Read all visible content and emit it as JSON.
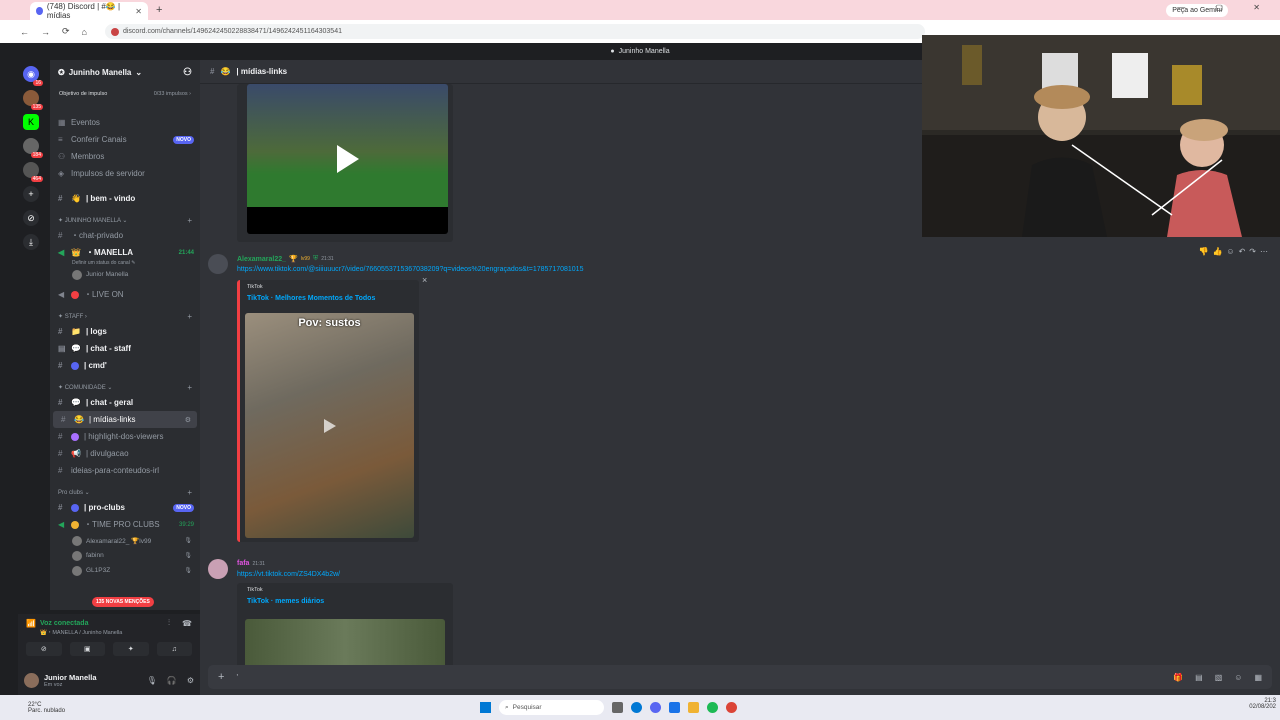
{
  "browser": {
    "tab_title": "(748) Discord | #😂 | mídias",
    "new_tab": "+",
    "url": "discord.com/channels/1496242450228838471/1496242451164303541",
    "gemini": "Peça ao Gemini",
    "window_controls": "—  ▢  ✕"
  },
  "titlebar": {
    "text": "Juninho Manella"
  },
  "servers": [
    {
      "label": "",
      "badge": "16"
    },
    {
      "label": "",
      "badge": "135"
    },
    {
      "label": "K",
      "badge": ""
    },
    {
      "label": "",
      "badge": "184"
    },
    {
      "label": "",
      "badge": "464"
    },
    {
      "label": "+",
      "badge": ""
    },
    {
      "label": "⊘",
      "badge": ""
    },
    {
      "label": "⤓",
      "badge": ""
    }
  ],
  "guild": {
    "name": "Juninho Manella",
    "boost_label": "Objetivo de impulso",
    "boost_value": "0/33 impulsos ›"
  },
  "nav": {
    "eventos": "Eventos",
    "conferir": "Conferir Canais",
    "conferir_badge": "NOVO",
    "membros": "Membros",
    "impulsos": "Impulsos de servidor"
  },
  "channels": {
    "bem_vindo": "| bem - vindo",
    "cat_manella": "✦ JUNINHO MANELLA ⌄",
    "chat_privado": "・chat-privado",
    "manella": "・MANELLA",
    "manella_time": "21:44",
    "manella_status": "Definir um status do canal ✎",
    "junior": "Junior Manella",
    "live_on": "・LIVE ON",
    "cat_staff": "✦ STAFF ›",
    "logs": "| logs",
    "chat_staff": "| chat - staff",
    "cmd": "| cmd'",
    "cat_comunidade": "✦ COMUNIDADE ⌄",
    "chat_geral": "| chat - geral",
    "midias": "| mídias-links",
    "highlight": "| highlight-dos-viewers",
    "divulgacao": "| divulgacao",
    "ideias": "ideias-para-conteudos-irl",
    "cat_pro": "Pro clubs ⌄",
    "pro_clubs": "| pro-clubs",
    "pro_badge": "NOVO",
    "time_pro": "・TIME PRO CLUBS",
    "time_pro_time": "39:29",
    "member1": "Alexamaral22_ 🏆lv99",
    "member2": "fabinn",
    "member3": "GL1P3Z",
    "mentions": "135 NOVAS MENÇÕES"
  },
  "voice": {
    "title": "Voz conectada",
    "sub": "👑・MANELLA / Juninho Manella"
  },
  "user": {
    "name": "Junior Manella",
    "status": "Em voz"
  },
  "chat": {
    "header": "| mídias-links",
    "msg1_author": "Alexamaral22_",
    "msg1_tag": "lv99",
    "msg1_time": "21:31",
    "msg1_link": "https://www.tiktok.com/@siiiuuucr7/video/7660553715367038209?q=videos%20engraçados&t=1785717081015",
    "embed1_provider": "TikTok",
    "embed1_title": "TikTok · Melhores Momentos de Todos",
    "embed1_video_text": "Pov: sustos",
    "msg2_author": "fafa",
    "msg2_time": "21:31",
    "msg2_link": "https://vt.tiktok.com/ZS4DX4b2w/",
    "embed2_provider": "TikTok",
    "embed2_title": "TikTok · memes diários",
    "close": "×",
    "composer_plus": "+",
    "composer_text": "'"
  },
  "taskbar": {
    "temp": "22°C",
    "weather": "Parc. nublado",
    "search": "Pesquisar",
    "time": "21:3",
    "date": "02/08/202"
  },
  "colors": {
    "accent": "#5865f2",
    "danger": "#f23f43",
    "online": "#23a55a",
    "link": "#00a8fc"
  }
}
